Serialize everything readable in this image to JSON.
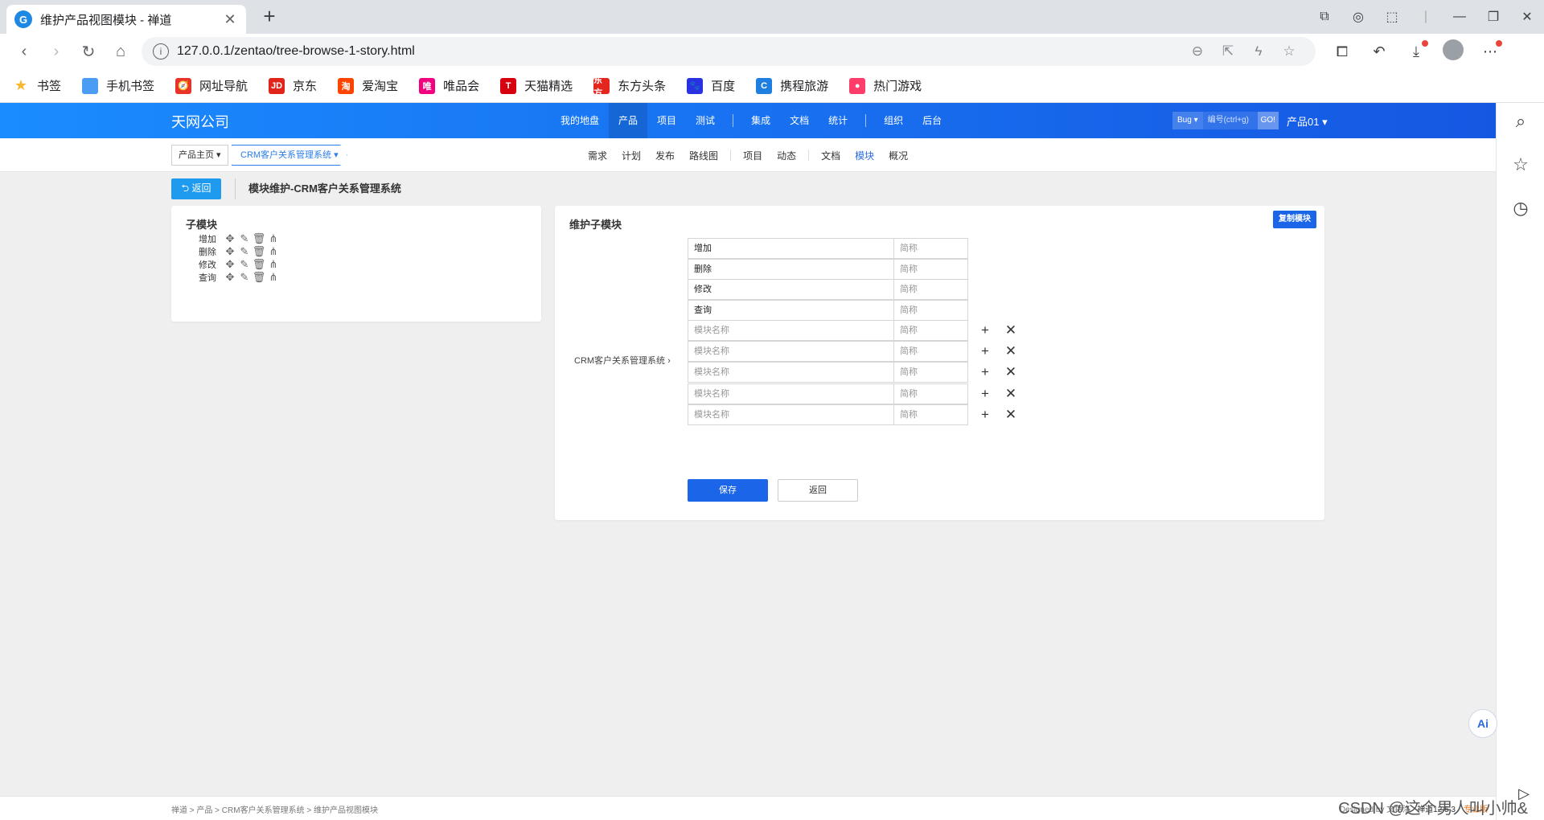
{
  "browser": {
    "tab_title": "维护产品视图模块 - 禅道",
    "favicon_letter": "G",
    "url": "127.0.0.1/zentao/tree-browse-1-story.html"
  },
  "bookmarks": [
    {
      "label": "书签",
      "color": "#f9b52c",
      "glyph": "★"
    },
    {
      "label": "手机书签",
      "color": "#4a9cf5",
      "glyph": ""
    },
    {
      "label": "网址导航",
      "color": "#e8332a",
      "glyph": "🧭"
    },
    {
      "label": "京东",
      "color": "#e1251b",
      "glyph": "JD"
    },
    {
      "label": "爱淘宝",
      "color": "#ff4400",
      "glyph": "淘"
    },
    {
      "label": "唯品会",
      "color": "#f10180",
      "glyph": "唯"
    },
    {
      "label": "天猫精选",
      "color": "#d7000f",
      "glyph": "T"
    },
    {
      "label": "东方头条",
      "color": "#e5261f",
      "glyph": "东方"
    },
    {
      "label": "百度",
      "color": "#2932e1",
      "glyph": "🐾"
    },
    {
      "label": "携程旅游",
      "color": "#1f7fe0",
      "glyph": "C"
    },
    {
      "label": "热门游戏",
      "color": "#ff3d6b",
      "glyph": "●"
    }
  ],
  "topnav": {
    "company": "天网公司",
    "menus": [
      "我的地盘",
      "产品",
      "项目",
      "测试",
      "|",
      "集成",
      "文档",
      "统计",
      "|",
      "组织",
      "后台"
    ],
    "active_menu": "产品",
    "search_type": "Bug ▾",
    "search_placeholder": "编号(ctrl+g)",
    "search_go": "GO!",
    "product_selector": "产品01 ▾"
  },
  "subnav": {
    "crumb_home": "产品主页 ▾",
    "crumb_product": "CRM客户关系管理系统 ▾",
    "tabs": [
      "需求",
      "计划",
      "发布",
      "路线图",
      "|",
      "项目",
      "动态",
      "|",
      "文档",
      "模块",
      "概况"
    ],
    "active_tab": "模块"
  },
  "page": {
    "back_label": "⮌ 返回",
    "title": "模块维护-CRM客户关系管理系统"
  },
  "left_panel": {
    "title": "子模块",
    "items": [
      "增加",
      "删除",
      "修改",
      "查询"
    ]
  },
  "right_panel": {
    "title": "维护子模块",
    "copy_button": "复制模块",
    "parent_label": "CRM客户关系管理系统 ›",
    "existing": [
      {
        "name": "增加",
        "short_placeholder": "简称"
      },
      {
        "name": "删除",
        "short_placeholder": "简称"
      },
      {
        "name": "修改",
        "short_placeholder": "简称"
      },
      {
        "name": "查询",
        "short_placeholder": "简称"
      }
    ],
    "new_rows": [
      {
        "name_placeholder": "模块名称",
        "short_placeholder": "简称"
      },
      {
        "name_placeholder": "模块名称",
        "short_placeholder": "简称"
      },
      {
        "name_placeholder": "模块名称",
        "short_placeholder": "简称"
      },
      {
        "name_placeholder": "模块名称",
        "short_placeholder": "简称"
      },
      {
        "name_placeholder": "模块名称",
        "short_placeholder": "简称"
      }
    ],
    "save_label": "保存",
    "return_label": "返回"
  },
  "footer": {
    "breadcrumb": "禅道 > 产品 > CRM客户关系管理系统 > 维护产品视图模块",
    "designed_by": "Designed by 文特洛",
    "version": "禅道12.5.3",
    "edition": "专业版"
  },
  "watermark": "CSDN @这个男人叫小帅&",
  "colors": {
    "nav_start": "#1a8cff",
    "nav_end": "#1657e2",
    "primary_button": "#1b66e8",
    "back_button": "#1e9bef"
  }
}
